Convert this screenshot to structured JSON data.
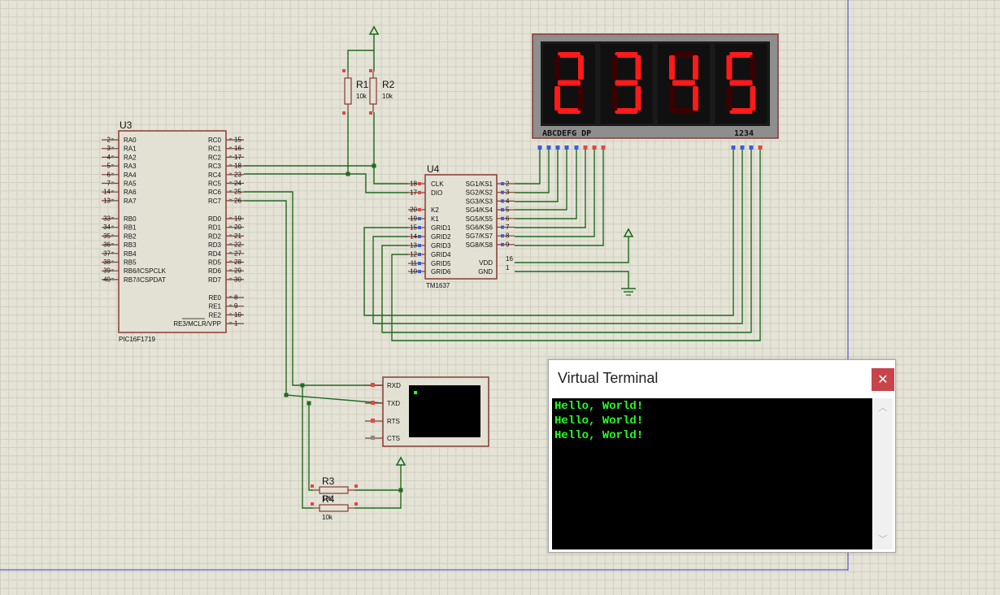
{
  "colors": {
    "wire": "#1f6b1f",
    "component_body": "#e2e1d4",
    "component_border": "#8a3a32",
    "pin": "#8a3a32",
    "seg_on": "#ff1a1a",
    "seg_off": "#3a0000",
    "display_bg": "#1a1a1a",
    "display_frame": "#8e8e8e",
    "terminal_text": "#23ff23",
    "close_red": "#c7444a"
  },
  "u3": {
    "ref": "U3",
    "part": "PIC16F1719",
    "left_pins": [
      {
        "num": "2",
        "name": "RA0"
      },
      {
        "num": "3",
        "name": "RA1"
      },
      {
        "num": "4",
        "name": "RA2"
      },
      {
        "num": "5",
        "name": "RA3"
      },
      {
        "num": "6",
        "name": "RA4"
      },
      {
        "num": "7",
        "name": "RA5"
      },
      {
        "num": "14",
        "name": "RA6"
      },
      {
        "num": "13",
        "name": "RA7"
      },
      {
        "num": "33",
        "name": "RB0"
      },
      {
        "num": "34",
        "name": "RB1"
      },
      {
        "num": "35",
        "name": "RB2"
      },
      {
        "num": "36",
        "name": "RB3"
      },
      {
        "num": "37",
        "name": "RB4"
      },
      {
        "num": "38",
        "name": "RB5"
      },
      {
        "num": "39",
        "name": "RB6/ICSPCLK"
      },
      {
        "num": "40",
        "name": "RB7/ICSPDAT"
      }
    ],
    "right_pins": [
      {
        "num": "15",
        "name": "RC0"
      },
      {
        "num": "16",
        "name": "RC1"
      },
      {
        "num": "17",
        "name": "RC2"
      },
      {
        "num": "18",
        "name": "RC3"
      },
      {
        "num": "23",
        "name": "RC4"
      },
      {
        "num": "24",
        "name": "RC5"
      },
      {
        "num": "25",
        "name": "RC6"
      },
      {
        "num": "26",
        "name": "RC7"
      },
      {
        "num": "19",
        "name": "RD0"
      },
      {
        "num": "20",
        "name": "RD1"
      },
      {
        "num": "21",
        "name": "RD2"
      },
      {
        "num": "22",
        "name": "RD3"
      },
      {
        "num": "27",
        "name": "RD4"
      },
      {
        "num": "28",
        "name": "RD5"
      },
      {
        "num": "29",
        "name": "RD6"
      },
      {
        "num": "30",
        "name": "RD7"
      },
      {
        "num": "8",
        "name": "RE0"
      },
      {
        "num": "9",
        "name": "RE1"
      },
      {
        "num": "10",
        "name": "RE2"
      },
      {
        "num": "1",
        "name": "RE3/MCLR/VPP"
      }
    ]
  },
  "u4": {
    "ref": "U4",
    "part": "TM1637",
    "left_pins": [
      {
        "num": "18",
        "name": "CLK"
      },
      {
        "num": "17",
        "name": "DIO"
      },
      {
        "num": "20",
        "name": "K2"
      },
      {
        "num": "19",
        "name": "K1"
      },
      {
        "num": "15",
        "name": "GRID1"
      },
      {
        "num": "14",
        "name": "GRID2"
      },
      {
        "num": "13",
        "name": "GRID3"
      },
      {
        "num": "12",
        "name": "GRID4"
      },
      {
        "num": "11",
        "name": "GRID5"
      },
      {
        "num": "10",
        "name": "GRID6"
      }
    ],
    "right_pins": [
      {
        "num": "2",
        "name": "SG1/KS1"
      },
      {
        "num": "3",
        "name": "SG2/KS2"
      },
      {
        "num": "4",
        "name": "SG3/KS3"
      },
      {
        "num": "5",
        "name": "SG4/KS4"
      },
      {
        "num": "6",
        "name": "SG5/KS5"
      },
      {
        "num": "7",
        "name": "SG6/KS6"
      },
      {
        "num": "8",
        "name": "SG7/KS7"
      },
      {
        "num": "9",
        "name": "SG8/KS8"
      }
    ],
    "power_pins": [
      {
        "num": "16",
        "name": "VDD"
      },
      {
        "num": "1",
        "name": "GND"
      }
    ]
  },
  "resistors": [
    {
      "ref": "R1",
      "value": "10k"
    },
    {
      "ref": "R2",
      "value": "10k"
    },
    {
      "ref": "R3",
      "value": "10k"
    },
    {
      "ref": "R4",
      "value": "10k"
    }
  ],
  "display": {
    "digits": [
      2,
      3,
      4,
      5
    ],
    "segment_label": "ABCDEFG DP",
    "digit_label": "1234"
  },
  "terminal_module": {
    "pins": [
      "RXD",
      "TXD",
      "RTS",
      "CTS"
    ]
  },
  "virtual_terminal": {
    "title": "Virtual Terminal",
    "close_glyph": "✕",
    "lines": [
      "Hello, World!",
      "Hello, World!",
      "Hello, World!"
    ],
    "scroll_up_glyph": "︿",
    "scroll_down_glyph": "﹀"
  }
}
